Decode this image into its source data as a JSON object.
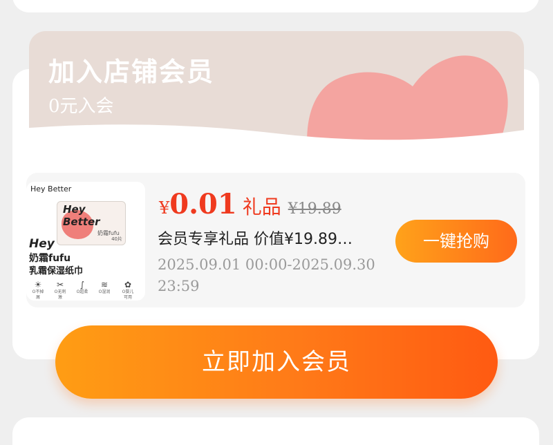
{
  "banner": {
    "title": "加入店铺会员",
    "subtitle": "0元入会"
  },
  "product": {
    "thumbnail": {
      "brand": "Hey Better",
      "pack_logo": "Hey Better",
      "pack_sub": "奶霜fufu",
      "pack_count": "40片",
      "key": "Hey",
      "line1": "奶霜fufu",
      "line2": "乳霜保湿纸巾",
      "features": [
        {
          "glyph": "☀",
          "label": "O不掉屑"
        },
        {
          "glyph": "✂",
          "label": "O无刺激"
        },
        {
          "glyph": "∫",
          "label": "O超柔"
        },
        {
          "glyph": "≋",
          "label": "O湿润"
        },
        {
          "glyph": "✿",
          "label": "O婴儿可用"
        }
      ]
    },
    "price_symbol": "¥",
    "price_value": "0.01",
    "price_tag": "礼品",
    "original_price": "¥19.89",
    "description": "会员专享礼品 价值¥19.89…",
    "date_start": "2025.09.01 00:00-2025.09.30",
    "date_end": "23:59",
    "buy_label": "一键抢购"
  },
  "join_label": "立即加入会员",
  "colors": {
    "accent": "#ef3a1f",
    "button_start": "#ffa21a",
    "button_end": "#ff5a12",
    "banner_bg": "#e8dcd6",
    "blob": "#f4a4a0"
  }
}
